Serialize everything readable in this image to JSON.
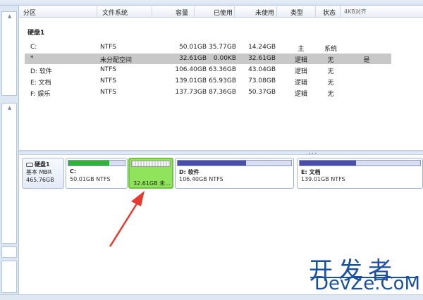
{
  "columns": [
    "分区",
    "文件系统",
    "容量",
    "已使用",
    "未使用",
    "类型",
    "状态",
    "4KB对齐"
  ],
  "disk": {
    "name": "硬盘1",
    "type": "基本 MBR",
    "size": "465.76GB"
  },
  "partitions": [
    {
      "name": "C:",
      "fs": "NTFS",
      "capacity": "50.01GB",
      "used": "35.77GB",
      "free": "14.24GB",
      "type": "主",
      "status": "系统",
      "align": ""
    },
    {
      "name": "*",
      "fs": "未分配空间",
      "capacity": "32.61GB",
      "used": "0.00KB",
      "free": "32.61GB",
      "type": "逻辑",
      "status": "无",
      "align": "是"
    },
    {
      "name": "D: 软件",
      "fs": "NTFS",
      "capacity": "106.40GB",
      "used": "63.36GB",
      "free": "43.04GB",
      "type": "逻辑",
      "status": "无",
      "align": ""
    },
    {
      "name": "E: 文档",
      "fs": "NTFS",
      "capacity": "139.01GB",
      "used": "65.93GB",
      "free": "73.08GB",
      "type": "逻辑",
      "status": "无",
      "align": ""
    },
    {
      "name": "F: 娱乐",
      "fs": "NTFS",
      "capacity": "137.73GB",
      "used": "87.36GB",
      "free": "50.37GB",
      "type": "逻辑",
      "status": "无",
      "align": ""
    }
  ],
  "diskmap": {
    "blocks": [
      {
        "label": "C:",
        "size": "50.01GB NTFS",
        "used_fraction": 0.72
      },
      {
        "label": "",
        "size": "32.61GB 未...",
        "used_fraction": 0.0
      },
      {
        "label": "D: 软件",
        "size": "106.40GB NTFS",
        "used_fraction": 0.6
      },
      {
        "label": "E: 文档",
        "size": "139.01GB NTFS",
        "used_fraction": 0.47
      }
    ]
  },
  "watermark": {
    "cn": "开发者",
    "en": "DevZe.CoM"
  },
  "colors": {
    "used_bar": "#4b4fa9",
    "system_bar": "#2fb533",
    "unallocated": "#90e45c",
    "arrow": "#e8392e",
    "watermark": "#1b4fa0"
  }
}
